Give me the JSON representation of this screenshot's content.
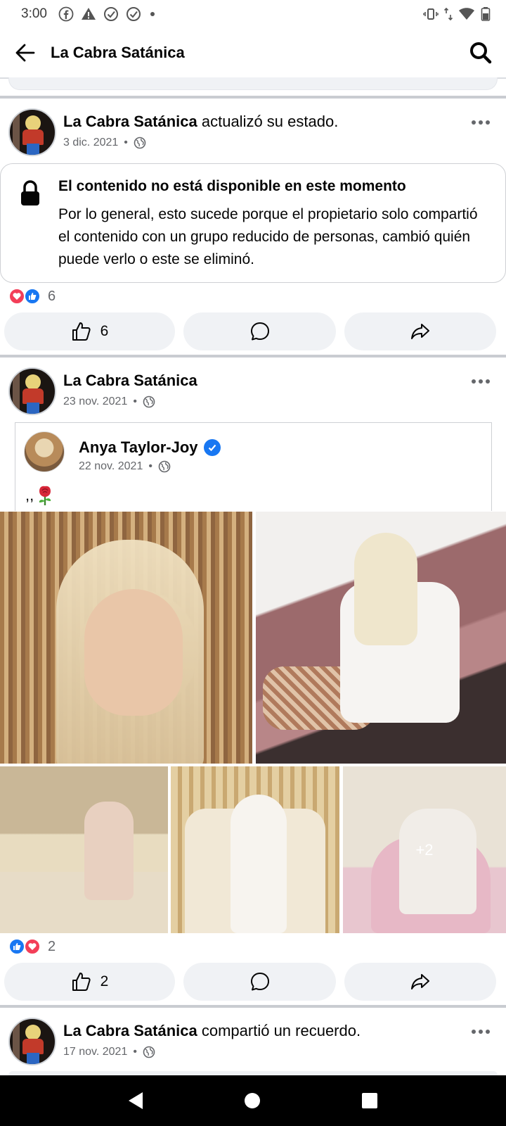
{
  "status_bar": {
    "time": "3:00",
    "left_icons": [
      "facebook-icon",
      "warning-icon",
      "check-circle-icon",
      "check-circle-icon",
      "dot-icon"
    ],
    "right_icons": [
      "vibrate-icon",
      "data-arrows-icon",
      "wifi-icon",
      "battery-icon"
    ]
  },
  "app_bar": {
    "title": "La Cabra Satánica",
    "back_icon": "arrow-left-icon",
    "search_icon": "search-icon"
  },
  "posts": [
    {
      "author": "La Cabra Satánica",
      "action": " actualizó su estado.",
      "date": "3 dic. 2021",
      "sep": "•",
      "audience_icon": "globe-icon",
      "unavailable": {
        "title": "El contenido no está disponible en este momento",
        "body": "Por lo general, esto sucede porque el propietario solo compartió el contenido con un grupo reducido de personas, cambió quién puede verlo o este se eliminó."
      },
      "reactions": {
        "types": [
          "love",
          "like"
        ],
        "count": "6"
      },
      "actions": {
        "like_count": "6"
      }
    },
    {
      "author": "La Cabra Satánica",
      "action": "",
      "date": "23 nov. 2021",
      "sep": "•",
      "audience_icon": "globe-icon",
      "shared": {
        "author": "Anya Taylor-Joy",
        "verified": true,
        "date": "22 nov. 2021",
        "sep": "•",
        "text": ",,",
        "emoji": "rose"
      },
      "photos": [
        "photo-1",
        "photo-2",
        "photo-3",
        "photo-4",
        "photo-5"
      ],
      "more_photos": "+2",
      "reactions": {
        "types": [
          "like",
          "love"
        ],
        "count": "2"
      },
      "actions": {
        "like_count": "2"
      }
    },
    {
      "author": "La Cabra Satánica",
      "action": " compartió un recuerdo.",
      "date": "17 nov. 2021",
      "sep": "•",
      "audience_icon": "globe-icon"
    }
  ],
  "colors": {
    "like_blue": "#1877f2",
    "love_red": "#f33e58",
    "secondary_text": "#65676b",
    "button_bg": "#f0f2f5"
  }
}
